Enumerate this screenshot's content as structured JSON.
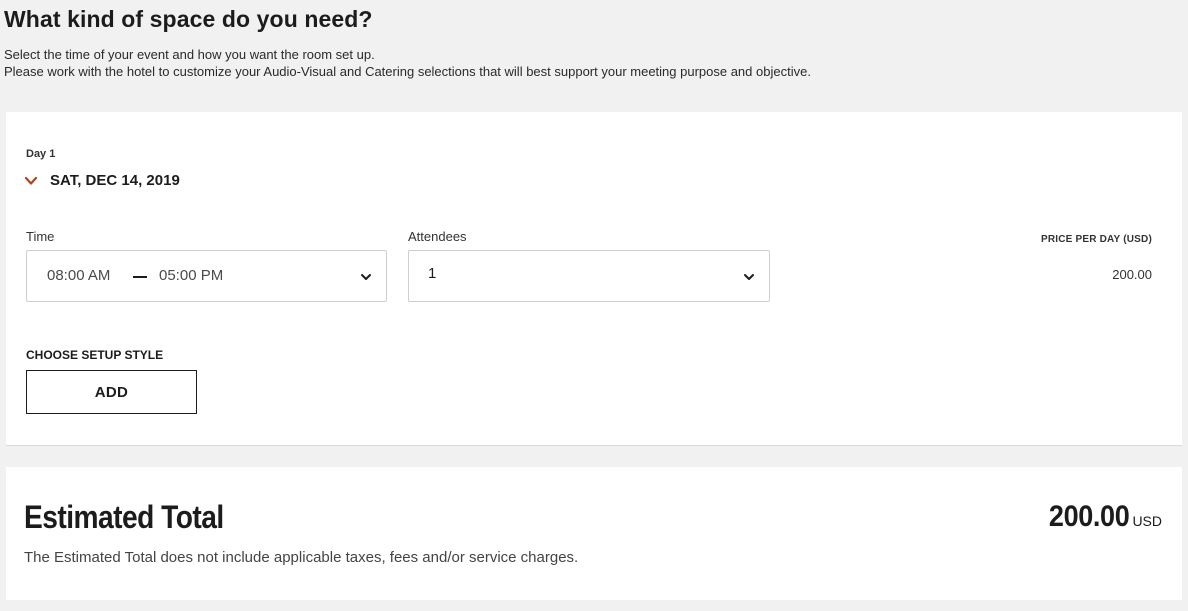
{
  "header": {
    "title": "What kind of space do you need?",
    "intro_line1": "Select the time of your event and how you want the room set up.",
    "intro_line2": "Please work with the hotel to customize your Audio-Visual and Catering selections that will best support your meeting purpose and objective."
  },
  "day": {
    "label": "Day 1",
    "date": "SAT, DEC 14, 2019",
    "toggle_icon": "chevron-down-icon",
    "accent_color": "#b5401e",
    "time": {
      "label": "Time",
      "start": "08:00 AM",
      "end": "05:00 PM",
      "icon": "chevron-down-icon"
    },
    "attendees": {
      "label": "Attendees",
      "value": "1",
      "icon": "chevron-down-icon"
    },
    "price": {
      "label": "PRICE PER DAY (USD)",
      "value": "200.00"
    },
    "setup": {
      "label": "CHOOSE SETUP STYLE",
      "button_label": "ADD"
    }
  },
  "total": {
    "title": "Estimated Total",
    "amount": "200.00",
    "currency": "USD",
    "note": "The Estimated Total does not include applicable taxes, fees and/or service charges."
  }
}
